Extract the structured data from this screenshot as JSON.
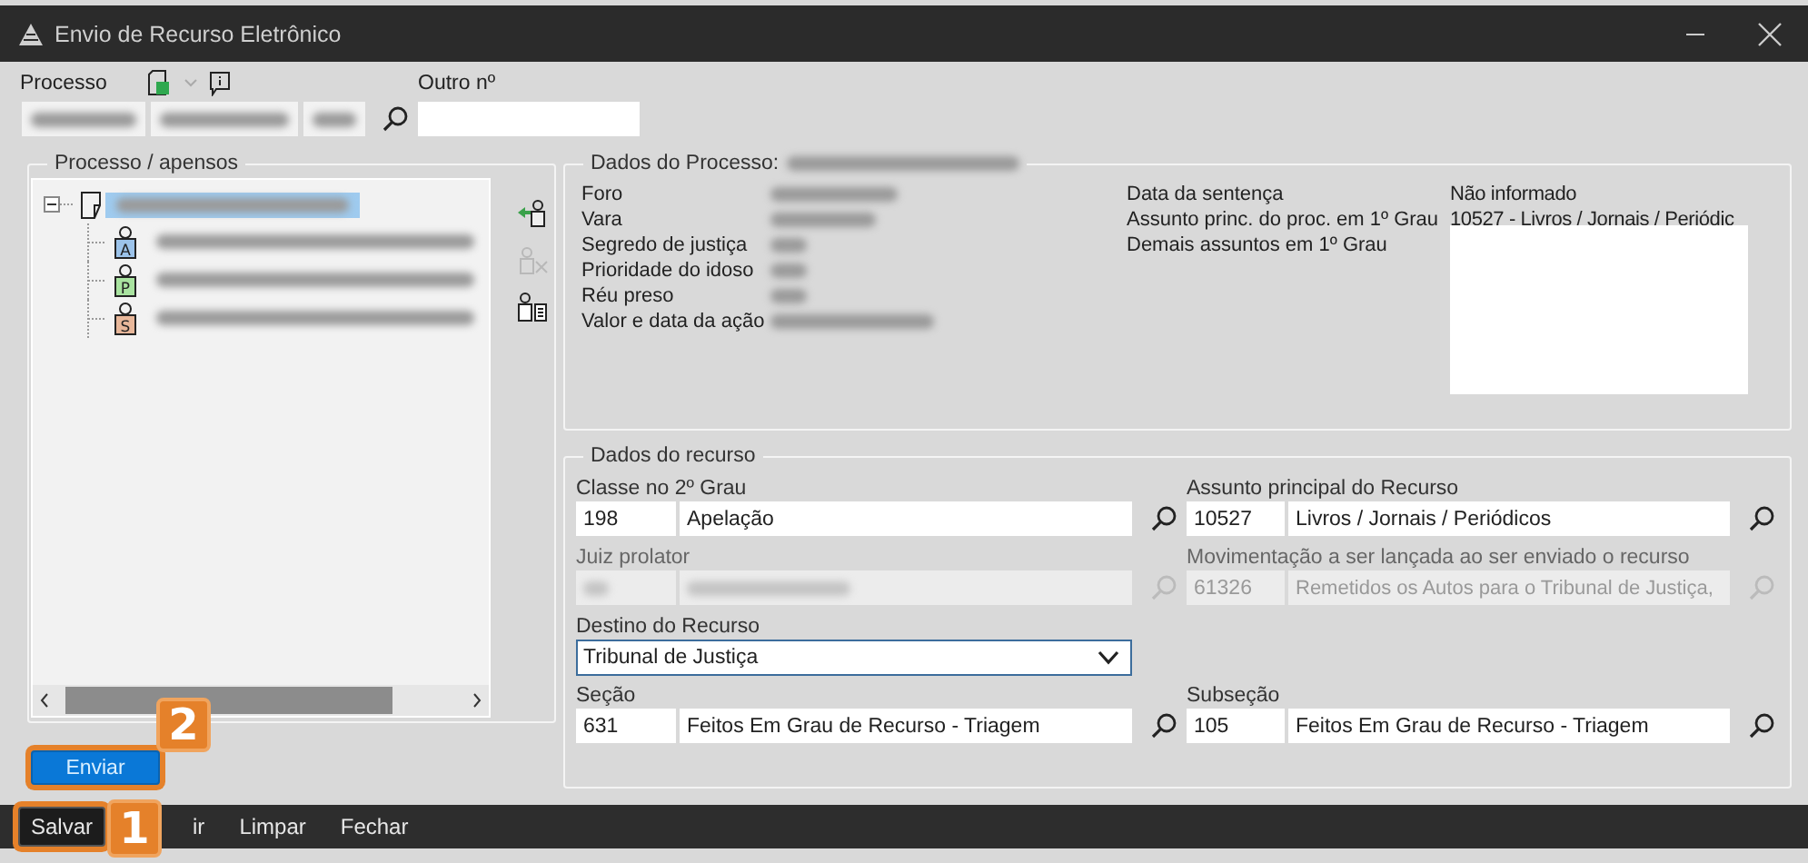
{
  "window": {
    "title": "Envio de Recurso Eletrônico"
  },
  "process_bar": {
    "label": "Processo",
    "fields": [
      {
        "redacted": true
      },
      {
        "redacted": true
      },
      {
        "redacted": true
      }
    ],
    "other_number_label": "Outro nº"
  },
  "tree_panel": {
    "title": "Processo / apensos",
    "root": {
      "redacted": true,
      "selected": true,
      "expanded": true,
      "children": [
        {
          "icon_letter": "A",
          "color": "#9cc3ea",
          "redacted": true
        },
        {
          "icon_letter": "P",
          "color": "#a9e3a0",
          "redacted": true
        },
        {
          "icon_letter": "S",
          "color": "#e8b79a",
          "redacted": true
        }
      ]
    }
  },
  "process_info": {
    "title": "Dados do Processo:",
    "number_redacted": true,
    "left_rows": [
      {
        "label": "Foro",
        "redacted": true
      },
      {
        "label": "Vara",
        "redacted": true
      },
      {
        "label": "Segredo de justiça",
        "redacted": true
      },
      {
        "label": "Prioridade do idoso",
        "redacted": true
      },
      {
        "label": "Réu preso",
        "redacted": true
      },
      {
        "label": "Valor e data da ação",
        "redacted": true
      }
    ],
    "right_rows": [
      {
        "kind": "text",
        "label": "Data da sentença",
        "value": "Não informado"
      },
      {
        "kind": "text",
        "label": "Assunto princ. do proc. em 1º Grau",
        "value": "10527 - Livros / Jornais / Periódic"
      },
      {
        "kind": "listbox",
        "label": "Demais assuntos em 1º Grau"
      }
    ]
  },
  "appeal": {
    "title": "Dados do recurso",
    "rows": [
      {
        "left": {
          "kind": "lookup",
          "label": "Classe no 2º Grau",
          "code": "198",
          "description": "Apelação",
          "disabled": false
        },
        "right": {
          "kind": "lookup",
          "label": "Assunto principal do Recurso",
          "code": "10527",
          "description": "Livros / Jornais / Periódicos",
          "disabled": false
        }
      },
      {
        "left": {
          "kind": "lookup",
          "label": "Juiz prolator",
          "disabled": true,
          "redacted": true
        },
        "right": {
          "kind": "lookup",
          "label": "Movimentação a ser lançada ao ser enviado o recurso",
          "code": "61326",
          "description": "Remetidos os Autos para o Tribunal de Justiça,",
          "disabled": true
        }
      },
      {
        "left": {
          "kind": "select",
          "label": "Destino do Recurso",
          "value": "Tribunal de Justiça"
        }
      },
      {
        "left": {
          "kind": "lookup",
          "label": "Seção",
          "code": "631",
          "description": "Feitos Em Grau de Recurso - Triagem",
          "disabled": false
        },
        "right": {
          "kind": "lookup",
          "label": "Subseção",
          "code": "105",
          "description": "Feitos Em Grau de Recurso - Triagem",
          "disabled": false
        }
      }
    ]
  },
  "send_button": {
    "label": "Enviar",
    "callout": "2"
  },
  "footer_buttons": [
    {
      "label": "Salvar",
      "focused": true,
      "callout": "1"
    },
    {
      "label": "ir",
      "focused": false
    },
    {
      "label": "Limpar",
      "focused": false
    },
    {
      "label": "Fechar",
      "focused": false
    }
  ]
}
